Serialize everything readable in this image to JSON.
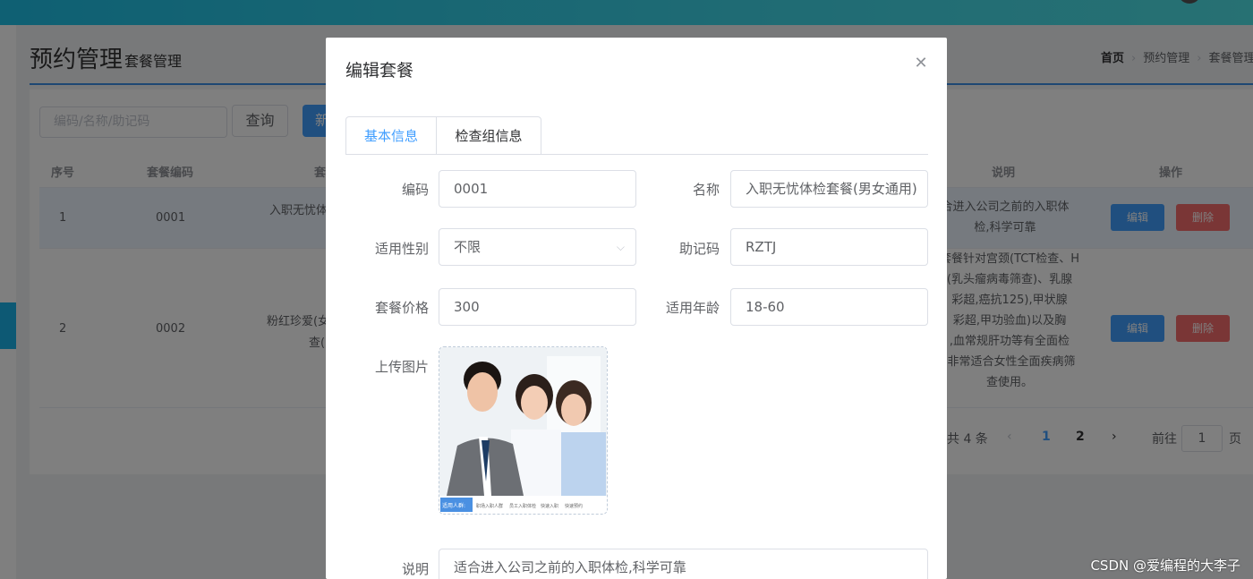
{
  "page": {
    "title": "预约管理",
    "subtitle": "套餐管理",
    "breadcrumb": [
      "首页",
      "预约管理",
      "套餐管理"
    ]
  },
  "toolbar": {
    "search_placeholder": "编码/名称/助记码",
    "query_label": "查询",
    "new_label": "新建"
  },
  "table": {
    "headers": [
      "序号",
      "套餐编码",
      "套",
      "说明",
      "操作"
    ],
    "rows": [
      {
        "index": "1",
        "code": "0001",
        "name": "入职无忧体",
        "desc": [
          "合进入公司之前的入职体",
          "检,科学可靠"
        ]
      },
      {
        "index": "2",
        "code": "0002",
        "name": "粉红珍爱(女",
        "name2": "查(",
        "desc": [
          "套餐针对宫颈(TCT检查、H",
          "(乳头瘤病毒筛查)、乳腺",
          "彩超,癌抗125),甲状腺",
          "彩超,甲功验血)以及胸",
          ",血常规肝功等有全面检",
          ",非常适合女性全面疾病筛",
          "查使用。"
        ]
      }
    ],
    "edit_label": "编辑",
    "delete_label": "删除"
  },
  "pagination": {
    "total": "共 4 条",
    "prev": "‹",
    "pages": [
      "1",
      "2"
    ],
    "next": "›",
    "goto": "前往",
    "page_input": "1",
    "page_suffix": "页"
  },
  "dialog": {
    "title": "编辑套餐",
    "tabs": [
      "基本信息",
      "检查组信息"
    ],
    "fields": {
      "code_label": "编码",
      "code_value": "0001",
      "name_label": "名称",
      "name_value": "入职无忧体检套餐(男女通用)",
      "sex_label": "适用性别",
      "sex_value": "不限",
      "helpcode_label": "助记码",
      "helpcode_value": "RZTJ",
      "price_label": "套餐价格",
      "price_value": "300",
      "age_label": "适用年龄",
      "age_value": "18-60",
      "upload_label": "上传图片",
      "remark_label": "说明",
      "remark_value": "适合进入公司之前的入职体检,科学可靠"
    },
    "image_strip": [
      "适用人群:",
      "职场入职人群",
      "员工入职体检",
      "快速入职",
      "快速预约"
    ]
  },
  "watermark": "CSDN @爱编程的大李子",
  "colors": {
    "primary": "#409eff",
    "danger": "#f56c6c",
    "topbar": "#2fcbe7"
  }
}
